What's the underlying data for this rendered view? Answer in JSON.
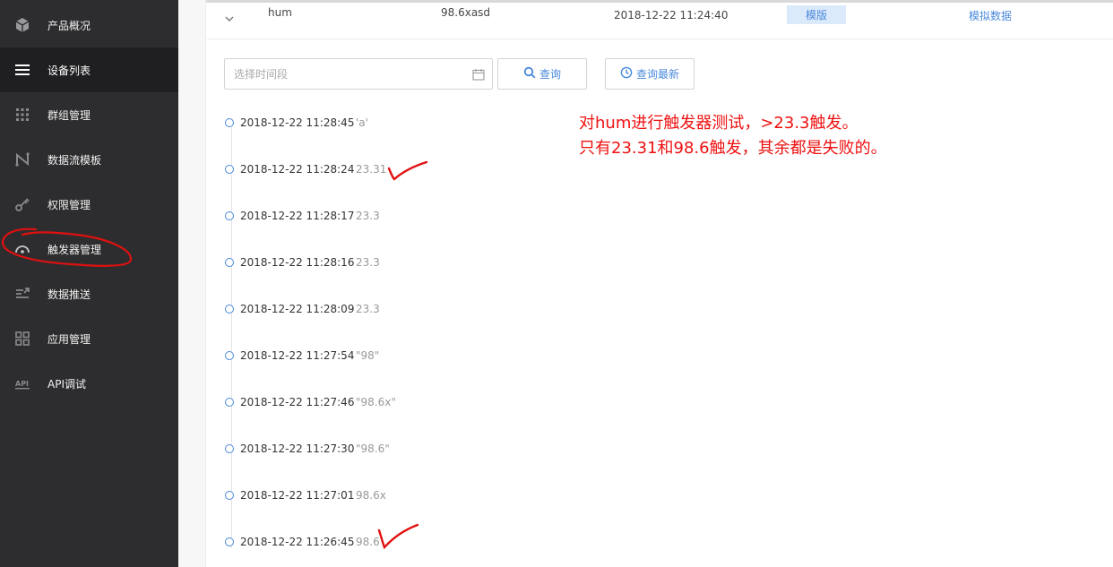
{
  "sidebar": {
    "items": [
      {
        "label": "产品概况",
        "icon": "cube-icon"
      },
      {
        "label": "设备列表",
        "icon": "list-icon",
        "active": true
      },
      {
        "label": "群组管理",
        "icon": "grid-dots-icon"
      },
      {
        "label": "数据流模板",
        "icon": "flow-icon"
      },
      {
        "label": "权限管理",
        "icon": "key-icon"
      },
      {
        "label": "触发器管理",
        "icon": "gauge-icon"
      },
      {
        "label": "数据推送",
        "icon": "push-icon"
      },
      {
        "label": "应用管理",
        "icon": "apps-icon"
      },
      {
        "label": "API调试",
        "icon": "api-icon"
      }
    ]
  },
  "datastream": {
    "name": "hum",
    "value": "98.6xasd",
    "time": "2018-12-22 11:24:40",
    "mode_badge": "模版",
    "simulate_link": "模拟数据"
  },
  "filter": {
    "placeholder": "选择时间段",
    "query_label": "查询",
    "latest_label": "查询最新"
  },
  "history": [
    {
      "time": "2018-12-22 11:28:45",
      "value": "'a'"
    },
    {
      "time": "2018-12-22 11:28:24",
      "value": "23.31"
    },
    {
      "time": "2018-12-22 11:28:17",
      "value": "23.3"
    },
    {
      "time": "2018-12-22 11:28:16",
      "value": "23.3"
    },
    {
      "time": "2018-12-22 11:28:09",
      "value": "23.3"
    },
    {
      "time": "2018-12-22 11:27:54",
      "value": "\"98\""
    },
    {
      "time": "2018-12-22 11:27:46",
      "value": "\"98.6x\""
    },
    {
      "time": "2018-12-22 11:27:30",
      "value": "\"98.6\""
    },
    {
      "time": "2018-12-22 11:27:01",
      "value": "98.6x"
    },
    {
      "time": "2018-12-22 11:26:45",
      "value": "98.6"
    }
  ],
  "annotation": {
    "line1": "对hum进行触发器测试，>23.3触发。",
    "line2": "只有23.31和98.6触发，其余都是失败的。"
  },
  "colors": {
    "sidebar_bg": "#2d2d2f",
    "accent": "#4a89dc",
    "annotation": "#ee1111"
  }
}
